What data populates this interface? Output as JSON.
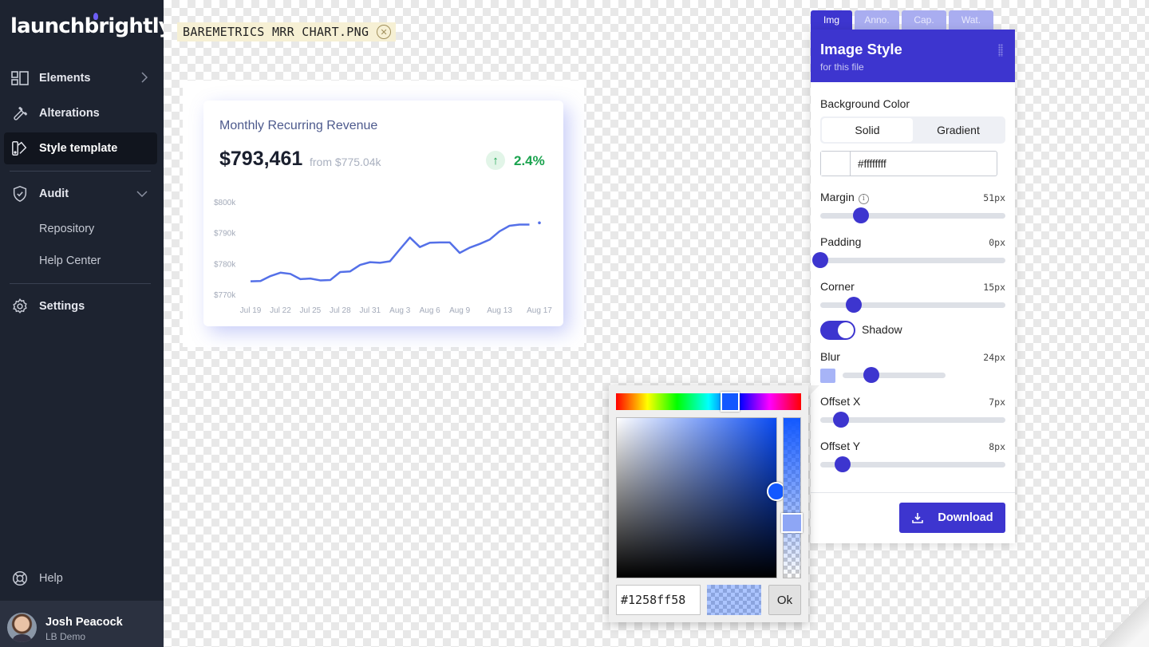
{
  "app": {
    "logo": "launchbrightly"
  },
  "sidebar": {
    "items": [
      {
        "label": "Elements",
        "icon": "layout-icon"
      },
      {
        "label": "Alterations",
        "icon": "wrench-icon"
      },
      {
        "label": "Style template",
        "icon": "palette-icon"
      },
      {
        "label": "Audit",
        "icon": "shield-check-icon"
      }
    ],
    "sub_items": [
      "Repository",
      "Help Center"
    ],
    "settings": "Settings",
    "help": "Help",
    "user": {
      "name": "Josh Peacock",
      "org": "LB Demo"
    }
  },
  "file": {
    "name": "BAREMETRICS MRR CHART.PNG"
  },
  "card": {
    "title": "Monthly Recurring Revenue",
    "value": "$793,461",
    "from": "from $775.04k",
    "change": "2.4%",
    "change_icon": "↑"
  },
  "chart_data": {
    "type": "line",
    "title": "Monthly Recurring Revenue",
    "x_ticks": [
      "Jul 19",
      "Jul 22",
      "Jul 25",
      "Jul 28",
      "Jul 31",
      "Aug 3",
      "Aug 6",
      "Aug 9",
      "Aug 13",
      "Aug 17"
    ],
    "y_ticks": [
      "$800k",
      "$790k",
      "$780k",
      "$770k"
    ],
    "ylim": [
      770000,
      800000
    ],
    "x": [
      "Jul 19",
      "Jul 20",
      "Jul 21",
      "Jul 22",
      "Jul 23",
      "Jul 24",
      "Jul 25",
      "Jul 26",
      "Jul 27",
      "Jul 28",
      "Jul 29",
      "Jul 30",
      "Jul 31",
      "Aug 1",
      "Aug 2",
      "Aug 3",
      "Aug 4",
      "Aug 5",
      "Aug 6",
      "Aug 7",
      "Aug 8",
      "Aug 9",
      "Aug 10",
      "Aug 11",
      "Aug 12",
      "Aug 13",
      "Aug 14",
      "Aug 15",
      "Aug 16",
      "Aug 17"
    ],
    "values": [
      774500,
      774600,
      776200,
      777300,
      776900,
      775200,
      775400,
      774800,
      774900,
      777500,
      777700,
      779800,
      780700,
      780500,
      781000,
      784900,
      788700,
      785600,
      787000,
      787100,
      787100,
      783700,
      785400,
      786600,
      788000,
      790700,
      792500,
      792900,
      792900,
      793461
    ],
    "line_color": "#5470e8",
    "grid": false
  },
  "panel": {
    "tabs": [
      "Img",
      "Anno.",
      "Cap.",
      "Wat."
    ],
    "title": "Image Style",
    "subtitle": "for this file",
    "background_color_label": "Background Color",
    "bg_options": [
      "Solid",
      "Gradient"
    ],
    "bg_selected": "Solid",
    "bg_hex": "#ffffffff",
    "sliders": [
      {
        "label": "Margin",
        "value": "51px",
        "level": 0.22
      },
      {
        "label": "Padding",
        "value": "0px",
        "level": 0.0
      },
      {
        "label": "Corner",
        "value": "15px",
        "level": 0.18
      },
      {
        "label": "Blur",
        "value": "24px",
        "level": 0.28
      },
      {
        "label": "Offset X",
        "value": "7px",
        "level": 0.11
      },
      {
        "label": "Offset Y",
        "value": "8px",
        "level": 0.12
      }
    ],
    "shadow_label": "Shadow",
    "shadow_on": true,
    "download_label": "Download",
    "accent": "#3d35cf"
  },
  "picker": {
    "hex": "#1258ff58",
    "ok_label": "Ok",
    "color": "#1258ff",
    "alpha": 0.35
  }
}
